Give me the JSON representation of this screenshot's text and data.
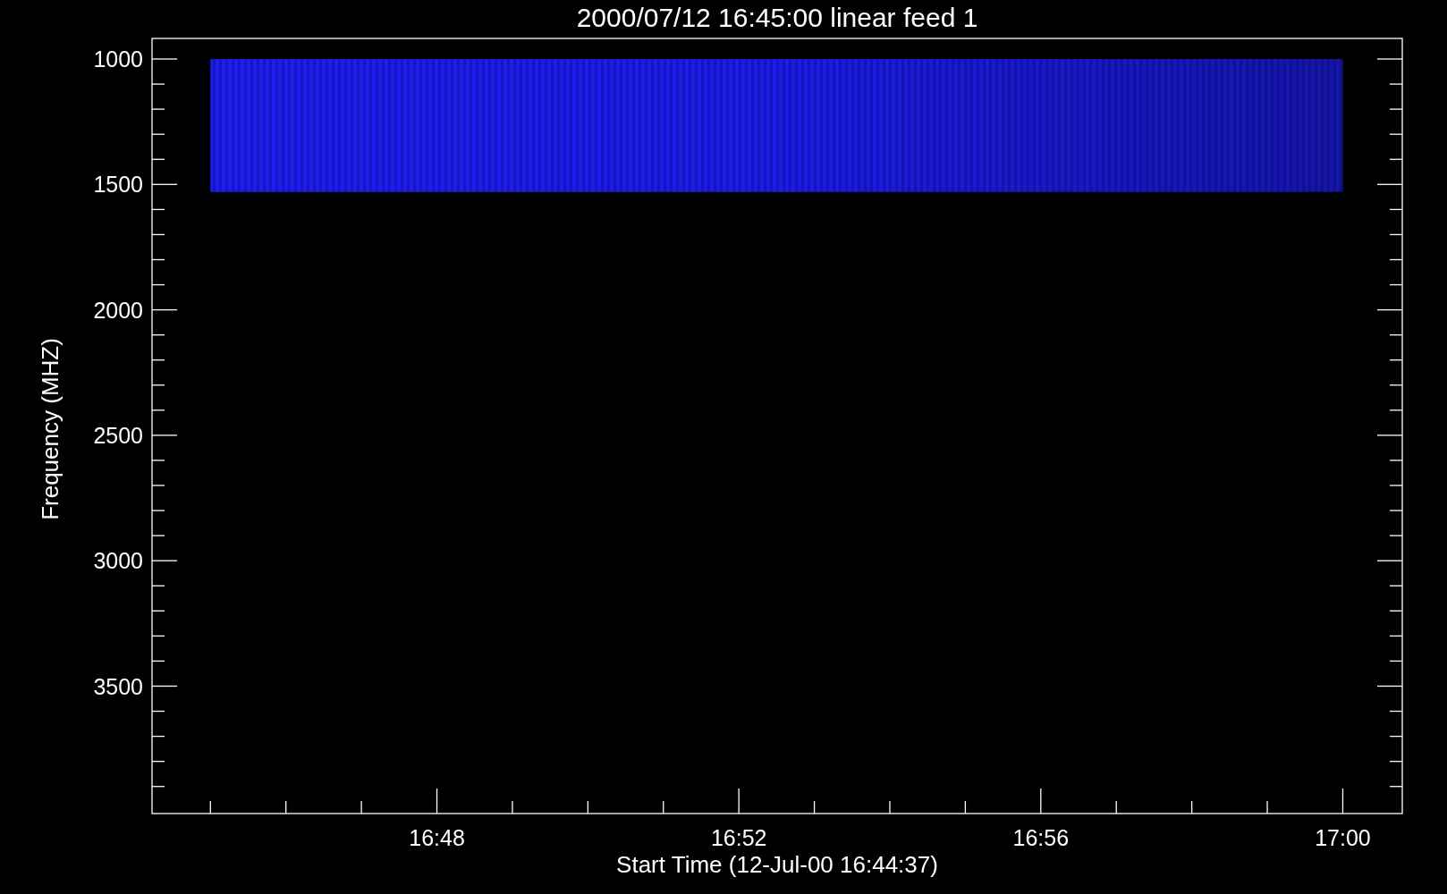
{
  "plot": {
    "title": "2000/07/12 16:45:00 linear feed 1",
    "ylabel": "Frequency (MHZ)",
    "xlabel": "Start Time (12-Jul-00 16:44:37)",
    "yticks": [
      "1000",
      "1500",
      "2000",
      "2500",
      "3000",
      "3500"
    ],
    "xticks": [
      "16:48",
      "16:52",
      "16:56",
      "17:00"
    ]
  }
}
